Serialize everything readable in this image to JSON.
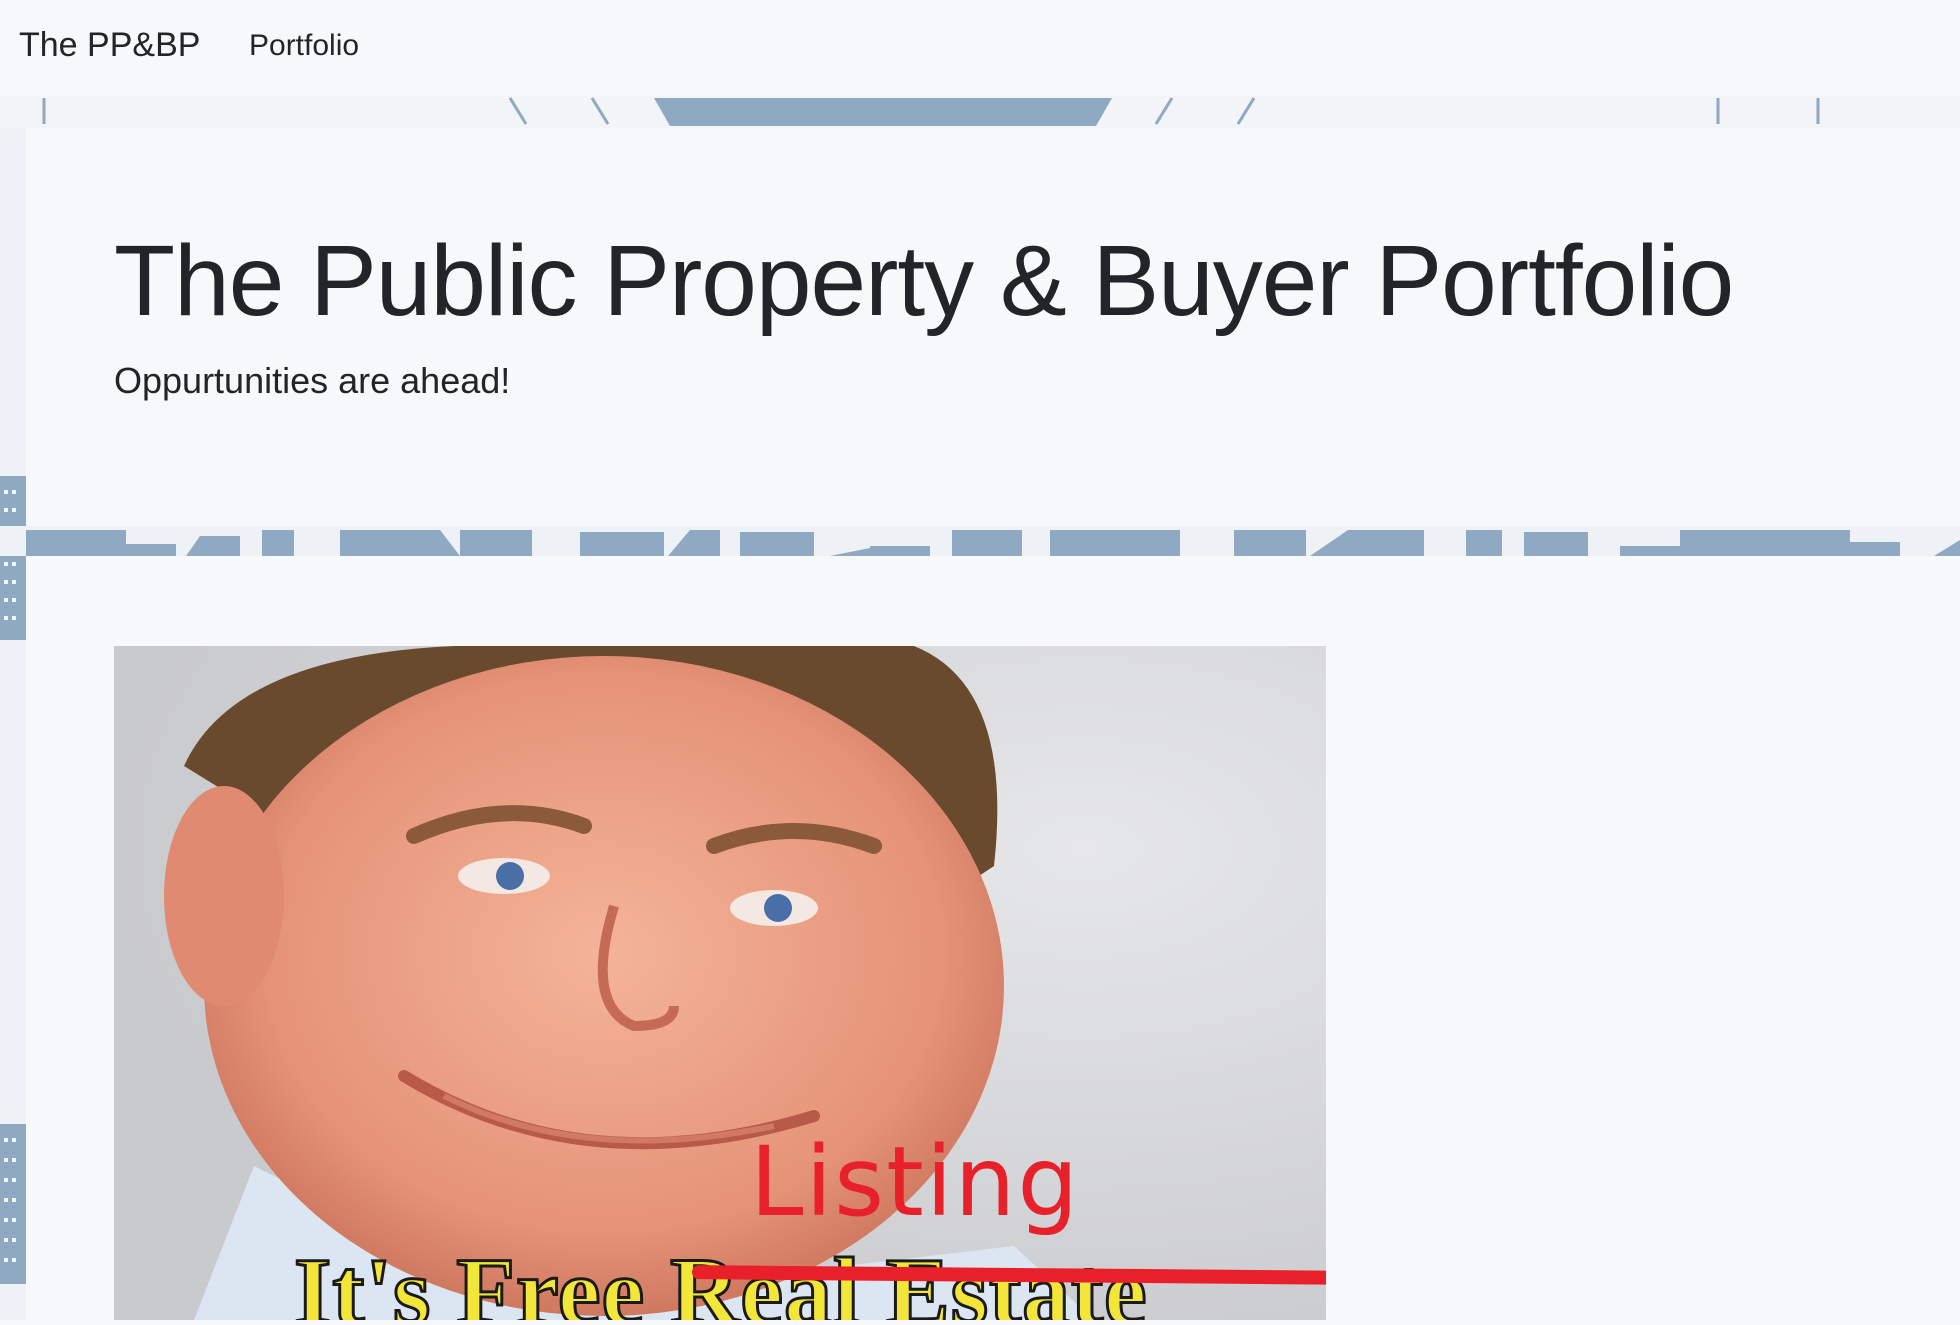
{
  "navbar": {
    "brand": "The PP&BP",
    "links": [
      {
        "label": "Portfolio"
      }
    ]
  },
  "header": {
    "title": "The Public Property & Buyer Portfolio",
    "subtitle": "Oppurtunities are ahead!"
  },
  "meme": {
    "caption_prefix": "It's Free ",
    "struck_text": "Real Estate",
    "handwritten_text": "Listing"
  },
  "colors": {
    "skyline": "#8fa9c2",
    "background": "#f7f8fa",
    "meme_caption": "#f3e63a",
    "handwriting": "#e8202a"
  }
}
